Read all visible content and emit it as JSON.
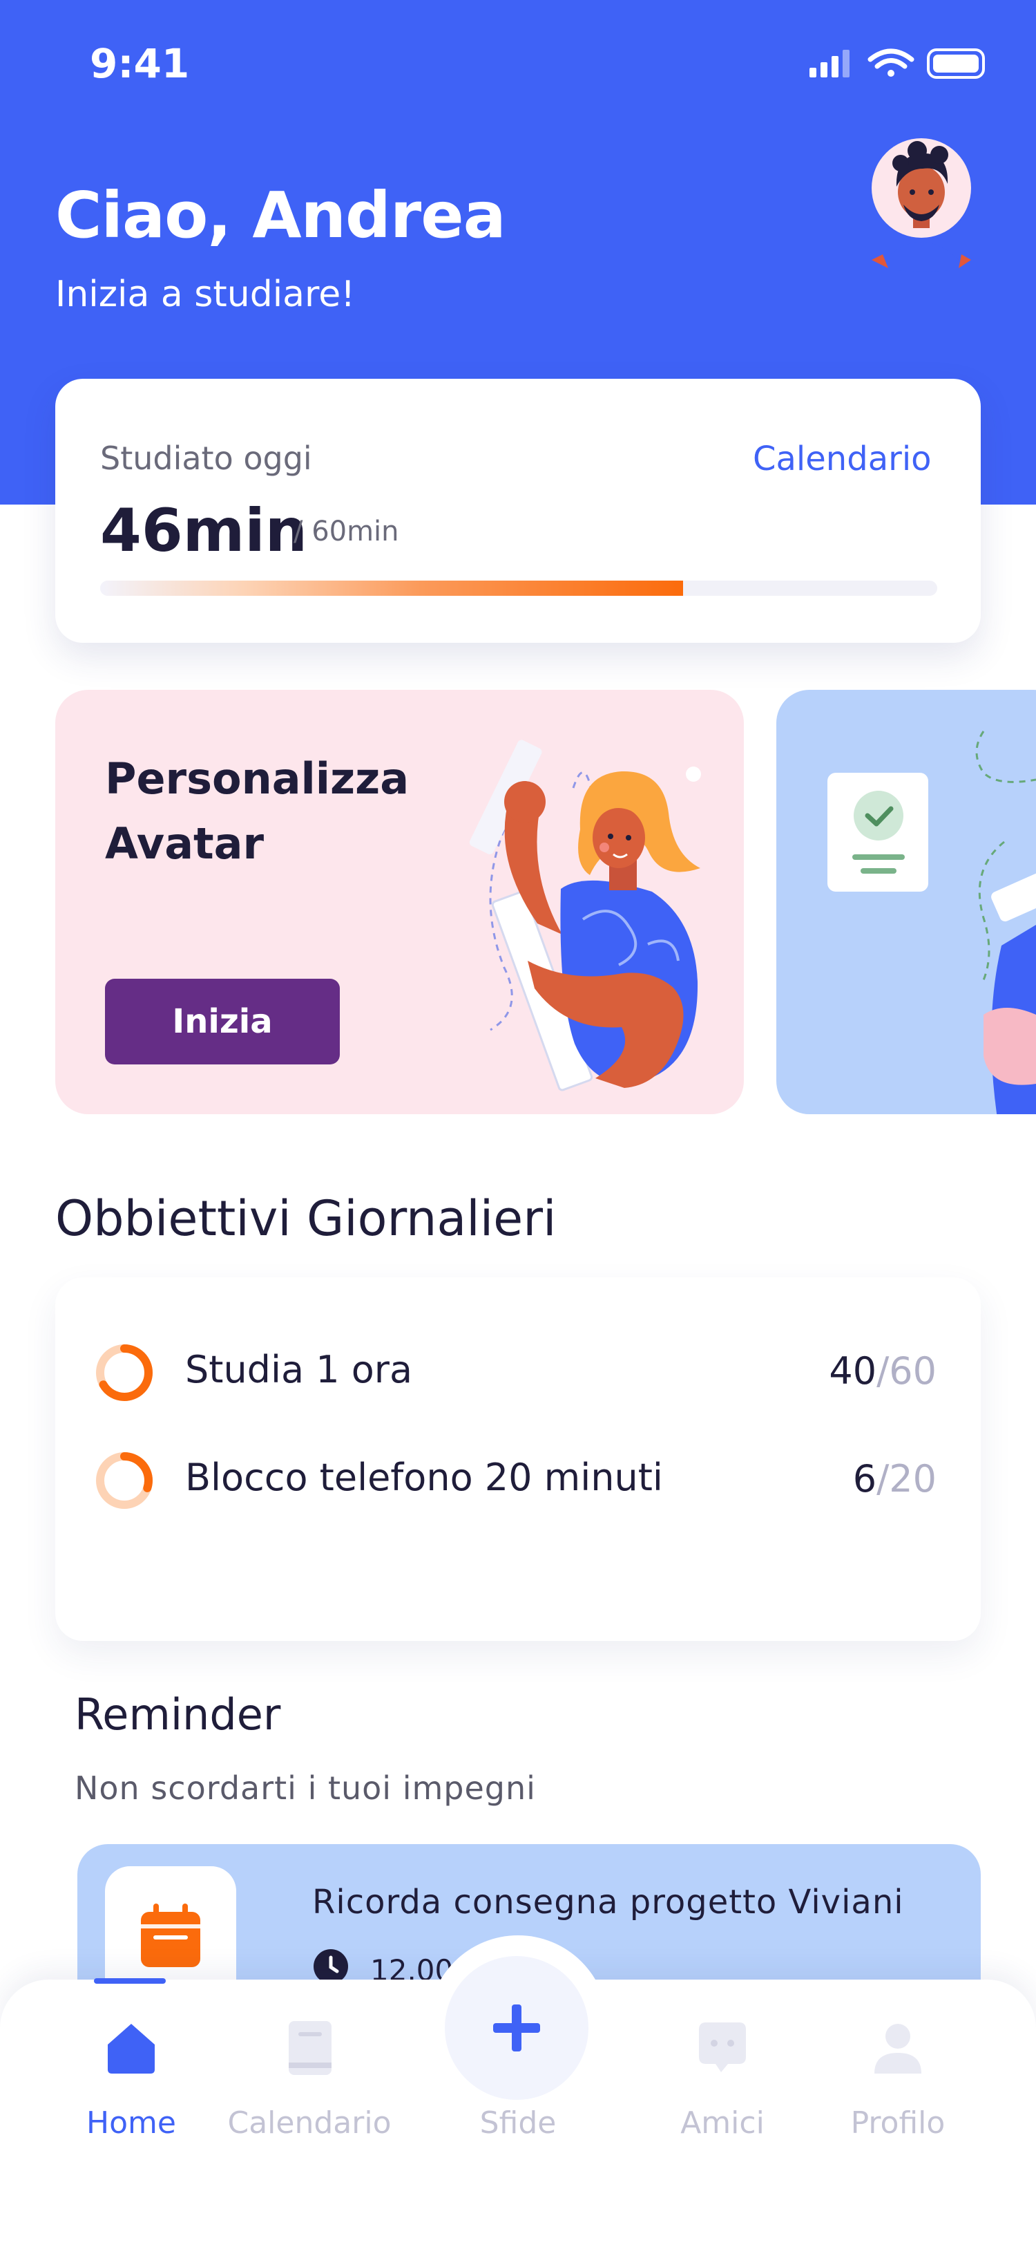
{
  "status_bar": {
    "time": "9:41"
  },
  "header": {
    "greeting": "Ciao, Andrea",
    "subtitle": "Inizia a studiare!"
  },
  "study_card": {
    "label": "Studiato oggi",
    "calendar_link": "Calendario",
    "value": "46min",
    "goal": "/ 60min",
    "progress_fraction": 0.6967
  },
  "promos": [
    {
      "title": "Personalizza Avatar",
      "button": "Inizia"
    }
  ],
  "daily_goals": {
    "title": "Obbiettivi Giornalieri",
    "items": [
      {
        "label": "Studia 1 ora",
        "done": "40",
        "separator": "/",
        "total": "60",
        "progress": 0.667
      },
      {
        "label": "Blocco telefono 20 minuti",
        "done": "6",
        "separator": "/",
        "total": "20",
        "progress": 0.3
      }
    ]
  },
  "reminder": {
    "title": "Reminder",
    "subtitle": "Non scordarti i tuoi impegni",
    "items": [
      {
        "text": "Ricorda consegna progetto Viviani",
        "time": "12.00"
      }
    ]
  },
  "bottom_nav": {
    "items": [
      {
        "label": "Home",
        "icon": "home-icon",
        "active": true
      },
      {
        "label": "Calendario",
        "icon": "book-icon",
        "active": false
      },
      {
        "label": "Sfide",
        "icon": "plus-icon",
        "active": false
      },
      {
        "label": "Amici",
        "icon": "chat-icon",
        "active": false
      },
      {
        "label": "Profilo",
        "icon": "profile-icon",
        "active": false
      }
    ]
  },
  "colors": {
    "primary": "#3f62f6",
    "accent_orange": "#fb6b0c",
    "button_purple": "#652d86",
    "promo_pink": "#fde6ec",
    "promo_blue": "#b7d1fb"
  }
}
